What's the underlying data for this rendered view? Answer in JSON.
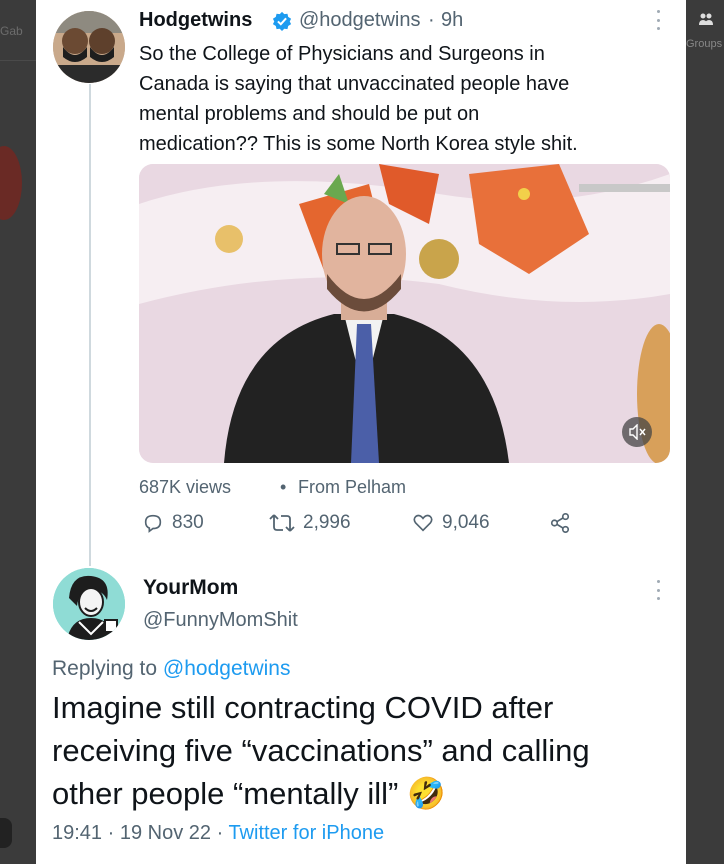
{
  "background": {
    "left_label": "Gab",
    "right_label": "Groups",
    "right_icon": "people-icon"
  },
  "tweet": {
    "author_name": "Hodgetwins",
    "author_handle": "@hodgetwins",
    "separator": "·",
    "time": "9h",
    "verified": true,
    "text": "So the College of Physicians and Surgeons in Canada is saying that unvaccinated people have mental problems and should be put on medication?? This is some North Korea style shit.",
    "text_lines": [
      "So the College of Physicians and Surgeons in",
      "Canada is saying that unvaccinated people have",
      "mental problems and should be put on",
      "medication?? This is some North Korea style shit."
    ],
    "media": {
      "type": "video",
      "muted": true,
      "mute_icon": "speaker-mute-icon"
    },
    "views": "687K views",
    "from": "From Pelham",
    "replies": "830",
    "retweets": "2,996",
    "likes": "9,046",
    "share_icon": "share-icon"
  },
  "reply": {
    "author_name": "YourMom",
    "author_handle": "@FunnyMomShit",
    "replying_to_label": "Replying to",
    "replying_to_handle": "@hodgetwins",
    "text_lines": [
      "Imagine still contracting COVID after",
      "receiving five “vaccinations” and calling",
      "other people “mentally ill”"
    ],
    "emoji": "🤣",
    "time": "19:41",
    "date": "19 Nov 22",
    "source": "Twitter for iPhone"
  },
  "colors": {
    "link": "#1d9bf0",
    "text": "#0f1419",
    "secondary": "#536471",
    "thread_line": "#cfd9de",
    "verified": "#1d9bf0"
  }
}
